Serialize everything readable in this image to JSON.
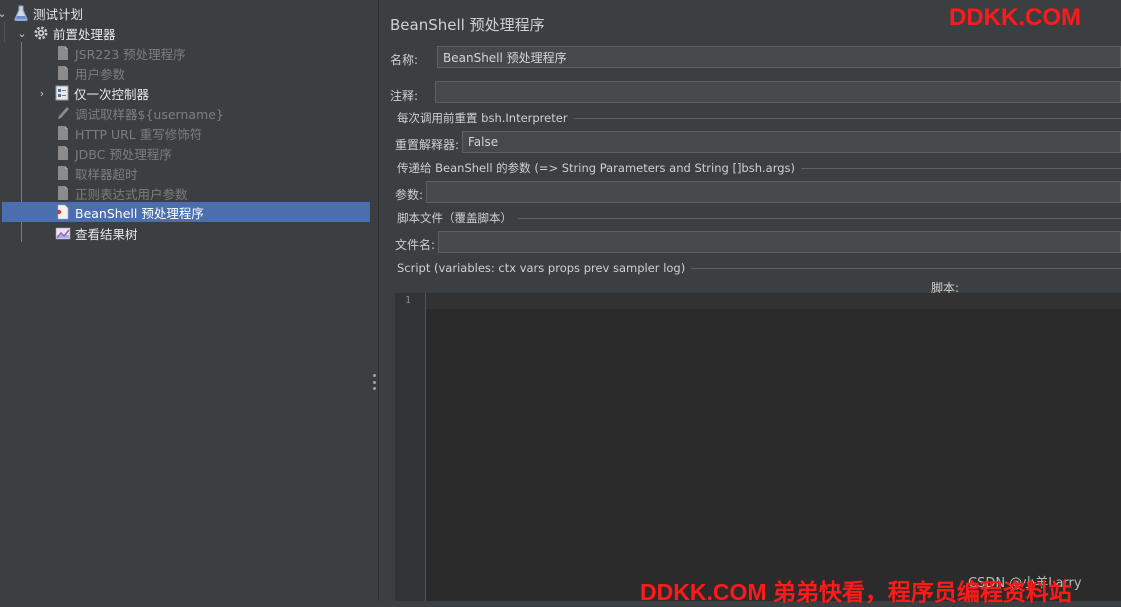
{
  "tree": {
    "root": {
      "label": "测试计划",
      "icon": "flask-icon"
    },
    "preprocessor_group": {
      "label": "前置处理器",
      "icon": "gear-icon"
    },
    "items": [
      {
        "label": "JSR223 预处理程序",
        "icon": "page-icon",
        "state": "disabled"
      },
      {
        "label": "用户参数",
        "icon": "page-icon",
        "state": "disabled"
      },
      {
        "label": "仅一次控制器",
        "icon": "controller-icon",
        "state": "enabled"
      },
      {
        "label": "调试取样器${username}",
        "icon": "pen-icon",
        "state": "disabled"
      },
      {
        "label": "HTTP URL 重写修饰符",
        "icon": "page-icon",
        "state": "disabled"
      },
      {
        "label": "JDBC 预处理程序",
        "icon": "page-icon",
        "state": "disabled"
      },
      {
        "label": "取样器超时",
        "icon": "page-icon",
        "state": "disabled"
      },
      {
        "label": "正则表达式用户参数",
        "icon": "page-icon",
        "state": "disabled"
      },
      {
        "label": "BeanShell 预处理程序",
        "icon": "beanshell-page-icon",
        "state": "selected"
      }
    ],
    "result_tree": {
      "label": "查看结果树",
      "icon": "chart-icon"
    }
  },
  "panel": {
    "title": "BeanShell 预处理程序",
    "name_label": "名称:",
    "name_value": "BeanShell 预处理程序",
    "comment_label": "注释:",
    "comment_value": "",
    "reset_group": "每次调用前重置 bsh.Interpreter",
    "reset_label": "重置解释器:",
    "reset_value": "False",
    "params_group": "传递给 BeanShell 的参数 (=> String Parameters and String []bsh.args)",
    "params_label": "参数:",
    "params_value": "",
    "file_group": "脚本文件（覆盖脚本）",
    "file_label": "文件名:",
    "file_value": "",
    "script_group": "Script (variables: ctx vars props prev sampler log)",
    "script_label": "脚本:",
    "line_number": "1"
  },
  "watermarks": {
    "top": "DDKK.COM",
    "bottom": "DDKK.COM 弟弟快看，程序员编程资料站",
    "csdn": "CSDN @小羊Larry"
  },
  "colors": {
    "background": "#3c3f41",
    "selection": "#4b6eaf",
    "editor": "#2b2b2b",
    "watermark": "#ff1a1a"
  }
}
